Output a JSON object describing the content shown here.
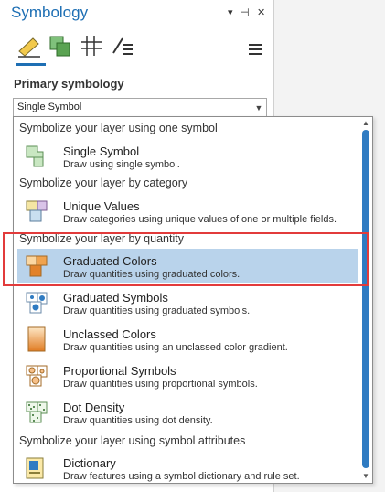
{
  "pane": {
    "title": "Symbology",
    "controls": {
      "dropdown": "▾",
      "pin": "⊣",
      "close": "✕"
    },
    "tabs": [
      {
        "name": "primary-symbology-tab"
      },
      {
        "name": "vary-symbology-tab"
      },
      {
        "name": "symbol-layers-tab"
      },
      {
        "name": "symbology-properties-tab"
      }
    ],
    "section_label": "Primary symbology",
    "combo_value": "Single Symbol"
  },
  "dropdown": {
    "groups": [
      {
        "header": "Symbolize your layer using one symbol",
        "items": [
          {
            "title": "Single Symbol",
            "desc": "Draw using single symbol.",
            "icon": "single-symbol-icon"
          }
        ]
      },
      {
        "header": "Symbolize your layer by category",
        "items": [
          {
            "title": "Unique Values",
            "desc": "Draw categories using unique values of one or multiple fields.",
            "icon": "unique-values-icon"
          }
        ]
      },
      {
        "header": "Symbolize your layer by quantity",
        "items": [
          {
            "title": "Graduated Colors",
            "desc": "Draw quantities using graduated colors.",
            "icon": "graduated-colors-icon"
          },
          {
            "title": "Graduated Symbols",
            "desc": "Draw quantities using graduated symbols.",
            "icon": "graduated-symbols-icon"
          },
          {
            "title": "Unclassed Colors",
            "desc": "Draw quantities using an unclassed color gradient.",
            "icon": "unclassed-colors-icon"
          },
          {
            "title": "Proportional Symbols",
            "desc": "Draw quantities using proportional symbols.",
            "icon": "proportional-symbols-icon"
          },
          {
            "title": "Dot Density",
            "desc": "Draw quantities using dot density.",
            "icon": "dot-density-icon"
          }
        ]
      },
      {
        "header": "Symbolize your layer using symbol attributes",
        "items": [
          {
            "title": "Dictionary",
            "desc": "Draw features using a symbol dictionary and rule set.",
            "icon": "dictionary-icon"
          }
        ]
      }
    ]
  },
  "colors": {
    "accent": "#1e6fb4",
    "selected_bg": "#b9d3eb",
    "highlight_border": "#e23b3b"
  }
}
